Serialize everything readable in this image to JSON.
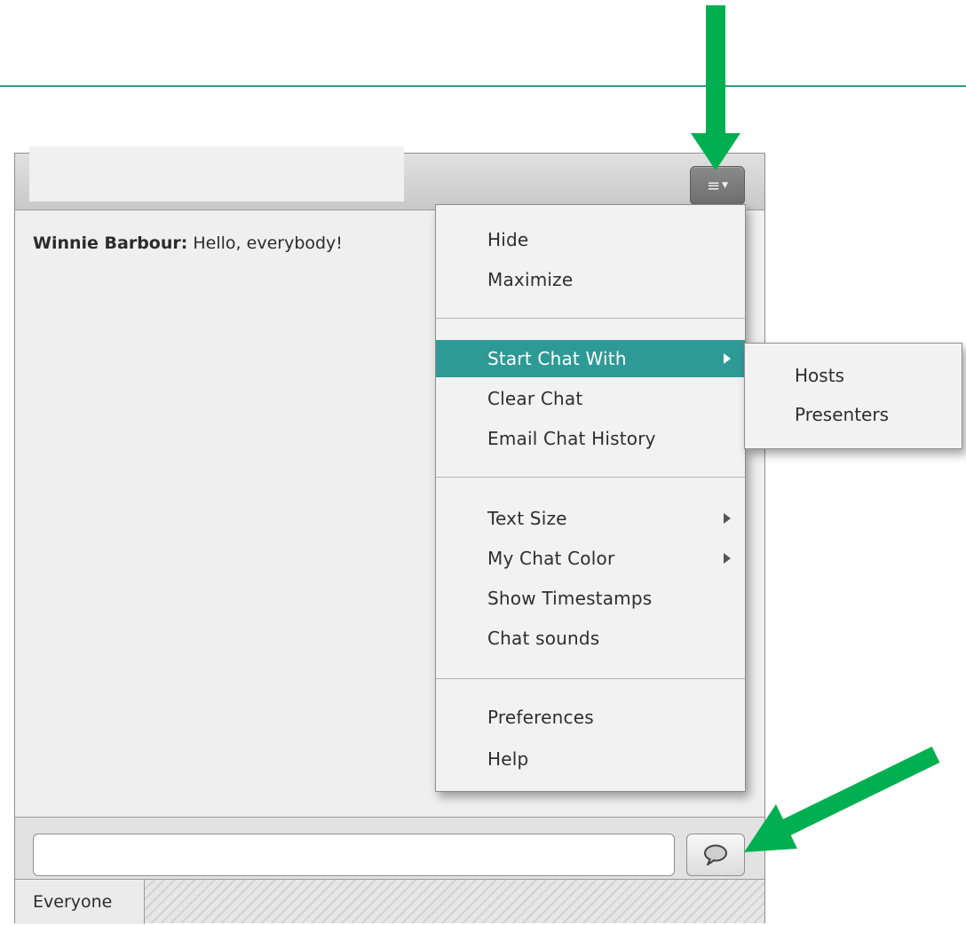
{
  "colors": {
    "accent": "#2e9a96",
    "annotation_arrow": "#00b050",
    "top_rule": "#2f9e86"
  },
  "pod": {
    "menu_button_icon": "menu-lines-icon",
    "chat": {
      "messages": [
        {
          "author": "Winnie Barbour:",
          "text": " Hello, everybody!"
        }
      ]
    },
    "input": {
      "value": "",
      "placeholder": ""
    },
    "send_icon": "speech-bubble-icon",
    "tabs": [
      {
        "label": "Everyone"
      }
    ]
  },
  "menu": {
    "items": [
      {
        "label": "Hide"
      },
      {
        "label": "Maximize"
      },
      {
        "label": "Start Chat With",
        "submenu": true,
        "highlighted": true
      },
      {
        "label": "Clear Chat"
      },
      {
        "label": "Email Chat History"
      },
      {
        "label": "Text Size",
        "submenu": true
      },
      {
        "label": "My Chat Color",
        "submenu": true
      },
      {
        "label": "Show Timestamps"
      },
      {
        "label": "Chat sounds"
      },
      {
        "label": "Preferences"
      },
      {
        "label": "Help"
      }
    ]
  },
  "submenu": {
    "items": [
      {
        "label": "Hosts"
      },
      {
        "label": "Presenters"
      }
    ]
  },
  "annotations": [
    {
      "icon": "arrow-down-icon"
    },
    {
      "icon": "arrow-down-left-icon"
    }
  ]
}
